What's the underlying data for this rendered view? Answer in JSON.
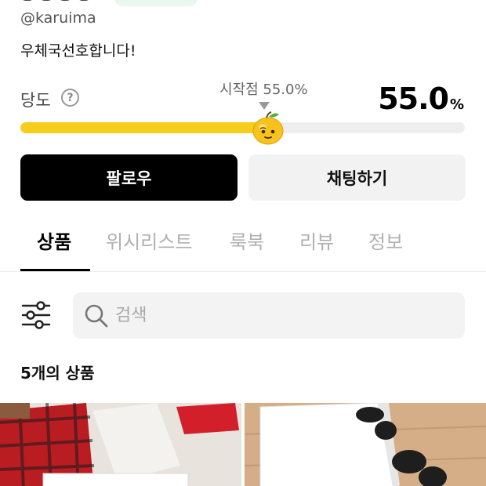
{
  "profile": {
    "username": "@karuima",
    "bio": "우체국선호합니다!"
  },
  "sweetness": {
    "label": "당도",
    "help_icon": "question-mark-icon",
    "start_text": "시작점 55.0%",
    "value": "55.0",
    "unit": "%",
    "level_fraction": 0.55,
    "accent_color": "#f5cd1a",
    "knob_icon": "apple-emoji-icon"
  },
  "actions": {
    "follow_label": "팔로우",
    "chat_label": "채팅하기"
  },
  "tabs": [
    {
      "label": "상품",
      "active": true
    },
    {
      "label": "위시리스트",
      "active": false
    },
    {
      "label": "룩북",
      "active": false
    },
    {
      "label": "리뷰",
      "active": false
    },
    {
      "label": "정보",
      "active": false
    }
  ],
  "search": {
    "placeholder": "검색",
    "filter_icon": "sliders-icon",
    "search_icon": "magnifier-icon"
  },
  "products": {
    "count_text": "5개의 상품",
    "thumbnails": [
      "product-photo-1",
      "product-photo-2"
    ]
  }
}
